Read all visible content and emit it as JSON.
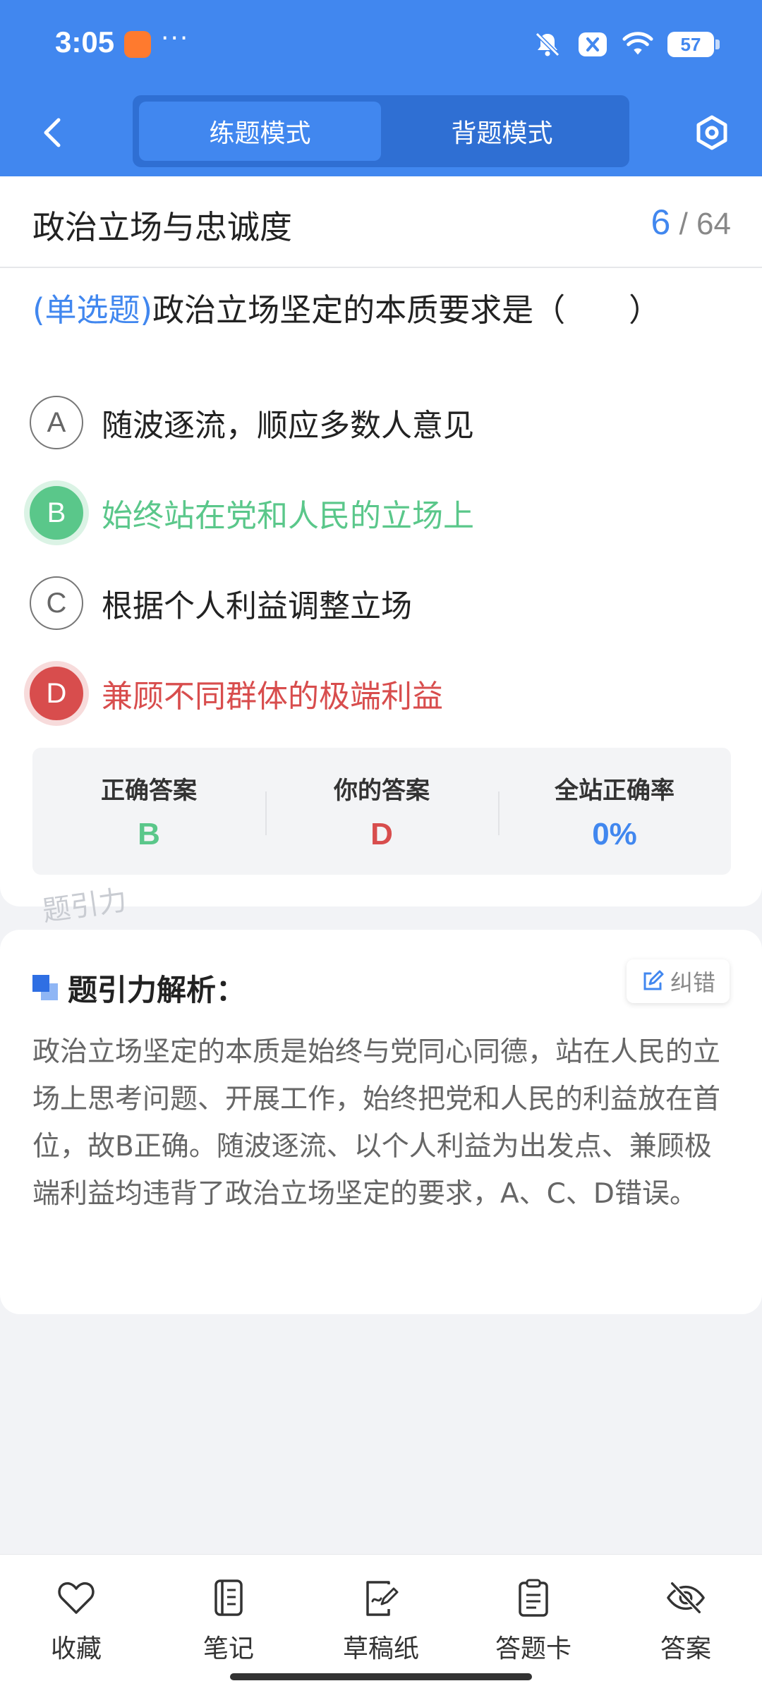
{
  "status_bar": {
    "time": "3:05",
    "more": "···",
    "battery": "57"
  },
  "nav": {
    "tabs": [
      "练题模式",
      "背题模式"
    ],
    "active_tab": 0
  },
  "chapter": {
    "title": "政治立场与忠诚度",
    "current": "6",
    "separator": "/",
    "total": "64"
  },
  "question": {
    "type": "(单选题)",
    "stem": "政治立场坚定的本质要求是（　　）",
    "options": [
      {
        "letter": "A",
        "text": "随波逐流，顺应多数人意见",
        "state": "normal"
      },
      {
        "letter": "B",
        "text": "始终站在党和人民的立场上",
        "state": "correct"
      },
      {
        "letter": "C",
        "text": "根据个人利益调整立场",
        "state": "normal"
      },
      {
        "letter": "D",
        "text": "兼顾不同群体的极端利益",
        "state": "wrong"
      }
    ]
  },
  "answer_summary": {
    "correct_label": "正确答案",
    "correct_value": "B",
    "yours_label": "你的答案",
    "yours_value": "D",
    "rate_label": "全站正确率",
    "rate_value": "0%"
  },
  "watermark": "题引力",
  "analysis": {
    "title": "题引力解析：",
    "fix_label": "纠错",
    "text": "政治立场坚定的本质是始终与党同心同德，站在人民的立场上思考问题、开展工作，始终把党和人民的利益放在首位，故B正确。随波逐流、以个人利益为出发点、兼顾极端利益均违背了政治立场坚定的要求，A、C、D错误。"
  },
  "bottom_bar": {
    "favorite": "收藏",
    "notes": "笔记",
    "draft": "草稿纸",
    "answer_card": "答题卡",
    "answer": "答案"
  },
  "colors": {
    "brand": "#4187ef",
    "correct": "#5ac78a",
    "wrong": "#d84d4d"
  }
}
